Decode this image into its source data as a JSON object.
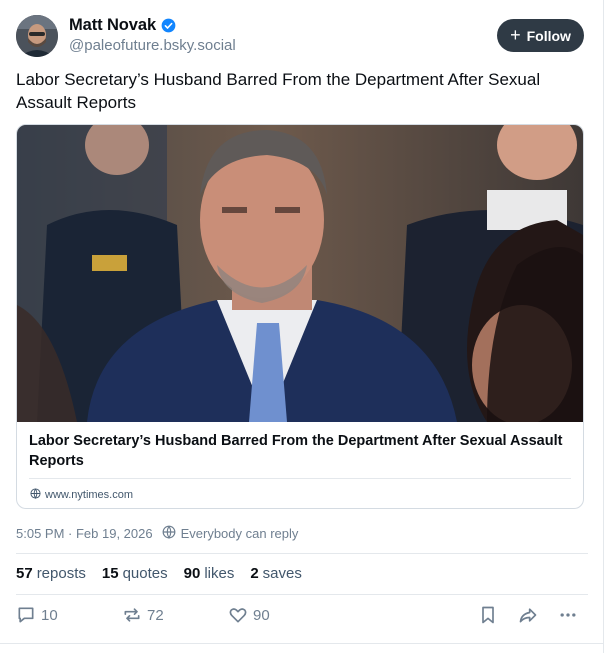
{
  "author": {
    "display_name": "Matt Novak",
    "handle": "@paleofuture.bsky.social",
    "verified_icon": "verified-check-icon",
    "accent_color": "#1185fe"
  },
  "follow_button": {
    "icon": "plus-icon",
    "label": "Follow"
  },
  "post": {
    "text": "Labor Secretary’s Husband Barred From the Department After Sexual Assault Reports"
  },
  "link_card": {
    "title": "Labor Secretary’s Husband Barred From the Department After Sexual Assault Reports",
    "domain": "www.nytimes.com",
    "domain_icon": "globe-icon"
  },
  "meta": {
    "timestamp": "5:05 PM · Feb 19, 2026",
    "reply_setting": "Everybody can reply",
    "reply_icon": "globe-icon"
  },
  "stats": {
    "reposts_count": "57",
    "reposts_label": "reposts",
    "quotes_count": "15",
    "quotes_label": "quotes",
    "likes_count": "90",
    "likes_label": "likes",
    "saves_count": "2",
    "saves_label": "saves"
  },
  "actions": {
    "reply_count": "10",
    "repost_count": "72",
    "like_count": "90",
    "icons": [
      "reply-icon",
      "repost-icon",
      "heart-icon",
      "bookmark-icon",
      "share-icon",
      "more-icon"
    ]
  },
  "colors": {
    "text_primary": "#0b0f14",
    "text_secondary": "#6f7f90",
    "follow_bg": "#2f3a45",
    "border": "#e4e8ec"
  }
}
